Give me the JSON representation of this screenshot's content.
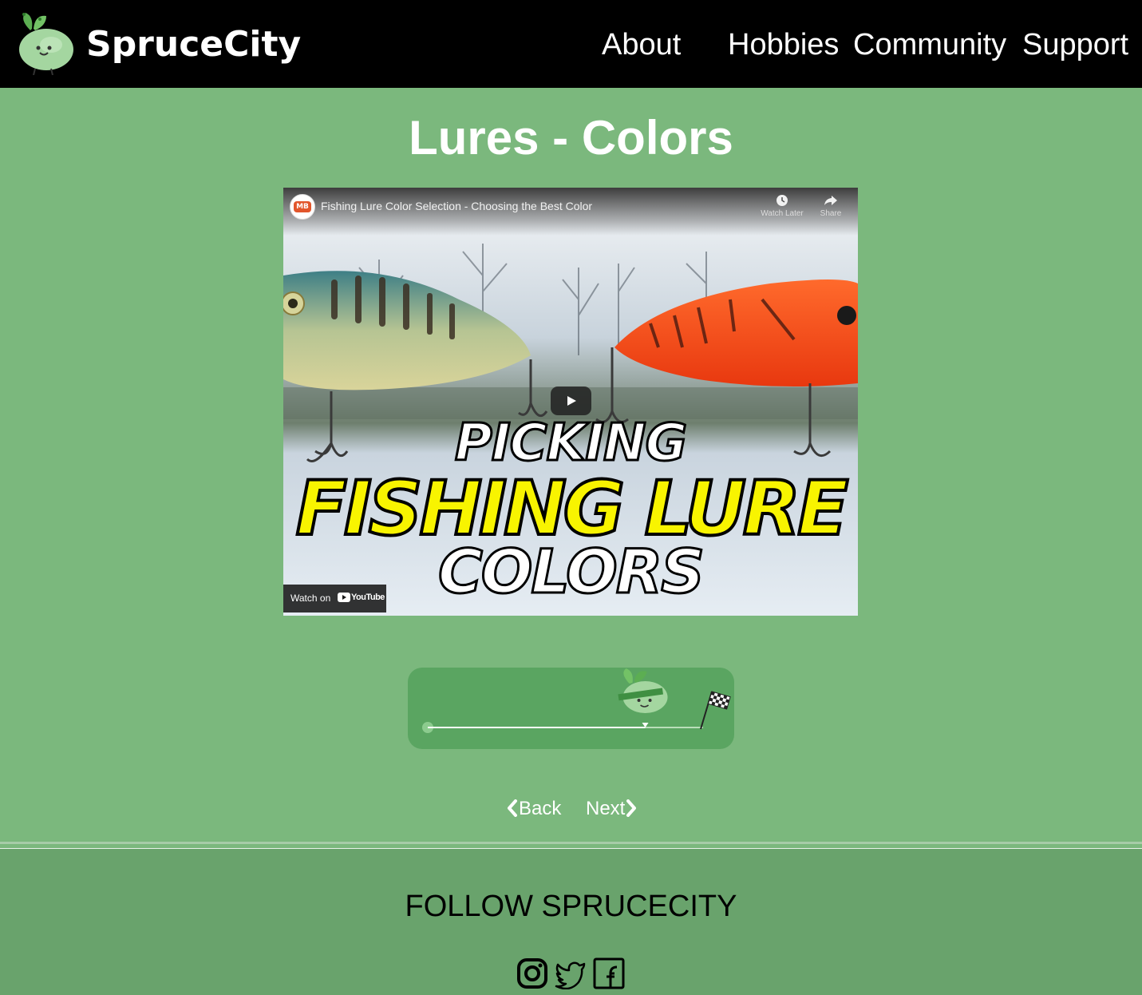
{
  "header": {
    "brand": "SpruceCity",
    "nav": [
      "About",
      "Hobbies",
      "Community",
      "Support"
    ]
  },
  "page": {
    "title": "Lures - Colors"
  },
  "video": {
    "channel_badge": "MB",
    "title": "Fishing Lure Color Selection - Choosing the Best Color",
    "watch_later": "Watch Later",
    "share": "Share",
    "thumb_line1": "PICKING",
    "thumb_line2": "FISHING LURE",
    "thumb_line3": "COLORS",
    "watch_on": "Watch on",
    "youtube": "YouTube"
  },
  "progress": {
    "value": 0.79
  },
  "pager": {
    "back": "Back",
    "next": "Next"
  },
  "footer": {
    "follow": "FOLLOW SPRUCECITY",
    "social": [
      "instagram-icon",
      "twitter-icon",
      "facebook-icon"
    ]
  },
  "colors": {
    "header_bg": "#000000",
    "page_bg": "#7bb87d",
    "footer_bg": "#69a36c",
    "progress_bg": "#5aa561",
    "lure_orange": "#f24a1b",
    "thumb_yellow": "#f8f400"
  }
}
